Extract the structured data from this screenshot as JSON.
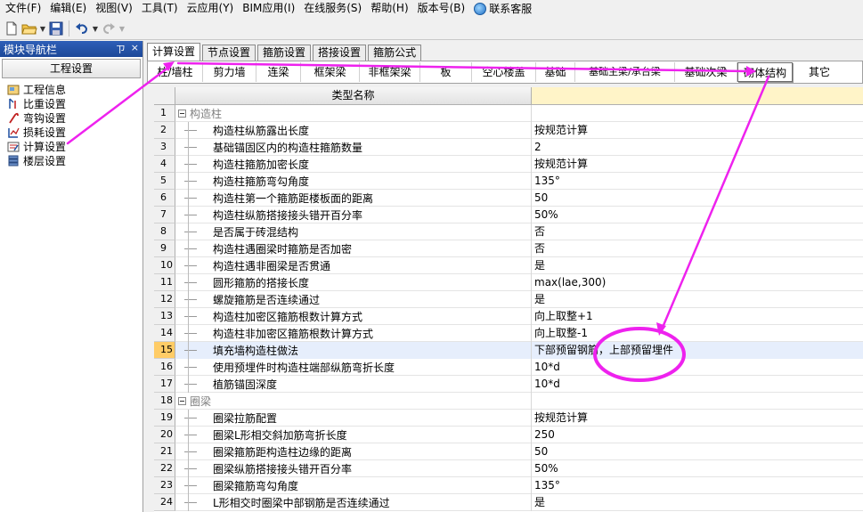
{
  "menu": [
    {
      "label": "文件(F)"
    },
    {
      "label": "编辑(E)"
    },
    {
      "label": "视图(V)"
    },
    {
      "label": "工具(T)"
    },
    {
      "label": "云应用(Y)"
    },
    {
      "label": "BIM应用(I)"
    },
    {
      "label": "在线服务(S)"
    },
    {
      "label": "帮助(H)"
    },
    {
      "label": "版本号(B)"
    }
  ],
  "contact_service": "联系客服",
  "left_panel": {
    "title": "模块导航栏",
    "pin_glyph": "ㄗ",
    "close_glyph": "×",
    "header": "工程设置",
    "items": [
      {
        "label": "工程信息",
        "icon": "project-info-icon"
      },
      {
        "label": "比重设置",
        "icon": "weight-settings-icon"
      },
      {
        "label": "弯钩设置",
        "icon": "hook-settings-icon"
      },
      {
        "label": "损耗设置",
        "icon": "loss-settings-icon"
      },
      {
        "label": "计算设置",
        "icon": "calc-settings-icon"
      },
      {
        "label": "楼层设置",
        "icon": "floor-settings-icon"
      }
    ]
  },
  "main_tabs": [
    {
      "label": "计算设置",
      "active": true
    },
    {
      "label": "节点设置",
      "active": false
    },
    {
      "label": "箍筋设置",
      "active": false
    },
    {
      "label": "搭接设置",
      "active": false
    },
    {
      "label": "箍筋公式",
      "active": false
    }
  ],
  "sub_tabs": [
    {
      "label": "柱/墙柱"
    },
    {
      "label": "剪力墙"
    },
    {
      "label": "连梁"
    },
    {
      "label": "框架梁"
    },
    {
      "label": "非框架梁"
    },
    {
      "label": "板"
    },
    {
      "label": "空心楼盖"
    },
    {
      "label": "基础"
    },
    {
      "label": "基础主梁/承台梁"
    },
    {
      "label": "基础次梁"
    },
    {
      "label": "砌体结构",
      "active": true
    },
    {
      "label": "其它"
    }
  ],
  "grid": {
    "header_name": "类型名称",
    "rows": [
      {
        "num": "1",
        "name": "构造柱",
        "value": "",
        "group": true
      },
      {
        "num": "2",
        "name": "构造柱纵筋露出长度",
        "value": "按规范计算"
      },
      {
        "num": "3",
        "name": "基础锚固区内的构造柱箍筋数量",
        "value": "2"
      },
      {
        "num": "4",
        "name": "构造柱箍筋加密长度",
        "value": "按规范计算"
      },
      {
        "num": "5",
        "name": "构造柱箍筋弯勾角度",
        "value": "135°"
      },
      {
        "num": "6",
        "name": "构造柱第一个箍筋距楼板面的距离",
        "value": "50"
      },
      {
        "num": "7",
        "name": "构造柱纵筋搭接接头错开百分率",
        "value": "50%"
      },
      {
        "num": "8",
        "name": "是否属于砖混结构",
        "value": "否"
      },
      {
        "num": "9",
        "name": "构造柱遇圈梁时箍筋是否加密",
        "value": "否"
      },
      {
        "num": "10",
        "name": "构造柱遇非圈梁是否贯通",
        "value": "是"
      },
      {
        "num": "11",
        "name": "圆形箍筋的搭接长度",
        "value": "max(lae,300)"
      },
      {
        "num": "12",
        "name": "螺旋箍筋是否连续通过",
        "value": "是"
      },
      {
        "num": "13",
        "name": "构造柱加密区箍筋根数计算方式",
        "value": "向上取整+1"
      },
      {
        "num": "14",
        "name": "构造柱非加密区箍筋根数计算方式",
        "value": "向上取整-1"
      },
      {
        "num": "15",
        "name": "填充墙构造柱做法",
        "value": "下部预留钢筋，上部预留埋件",
        "selected": true
      },
      {
        "num": "16",
        "name": "使用预埋件时构造柱端部纵筋弯折长度",
        "value": "10*d"
      },
      {
        "num": "17",
        "name": "植筋锚固深度",
        "value": "10*d"
      },
      {
        "num": "18",
        "name": "圈梁",
        "value": "",
        "group": true
      },
      {
        "num": "19",
        "name": "圈梁拉筋配置",
        "value": "按规范计算"
      },
      {
        "num": "20",
        "name": "圈梁L形相交斜加筋弯折长度",
        "value": "250"
      },
      {
        "num": "21",
        "name": "圈梁箍筋距构造柱边缘的距离",
        "value": "50"
      },
      {
        "num": "22",
        "name": "圈梁纵筋搭接接头错开百分率",
        "value": "50%"
      },
      {
        "num": "23",
        "name": "圈梁箍筋弯勾角度",
        "value": "135°"
      },
      {
        "num": "24",
        "name": "L形相交时圈梁中部钢筋是否连续通过",
        "value": "是"
      }
    ]
  },
  "colors": {
    "annotation": "#ee22ee",
    "header_value_bg": "#fff4c8",
    "selected_row_num": "#ffcc66"
  }
}
